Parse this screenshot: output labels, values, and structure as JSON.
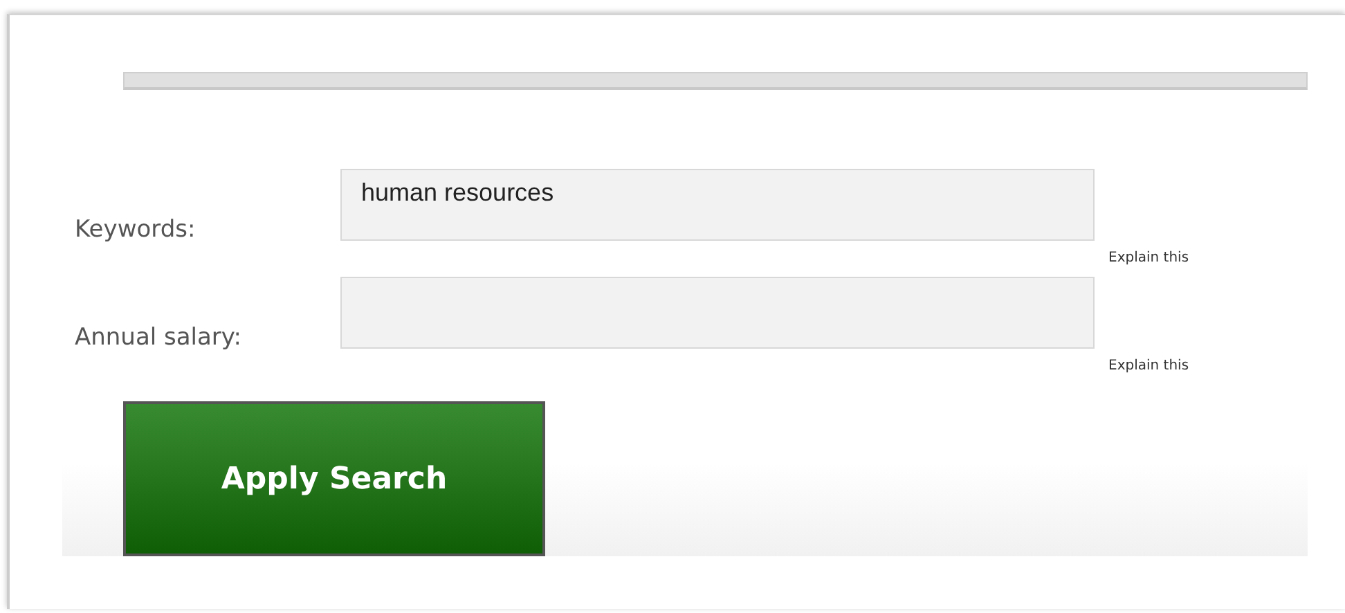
{
  "fields": [
    {
      "label": "Keywords:",
      "value": "human resources",
      "help": "Explain this"
    },
    {
      "label": "Annual salary:",
      "help": "Explain this"
    }
  ],
  "button": {
    "label": "Apply Search"
  }
}
